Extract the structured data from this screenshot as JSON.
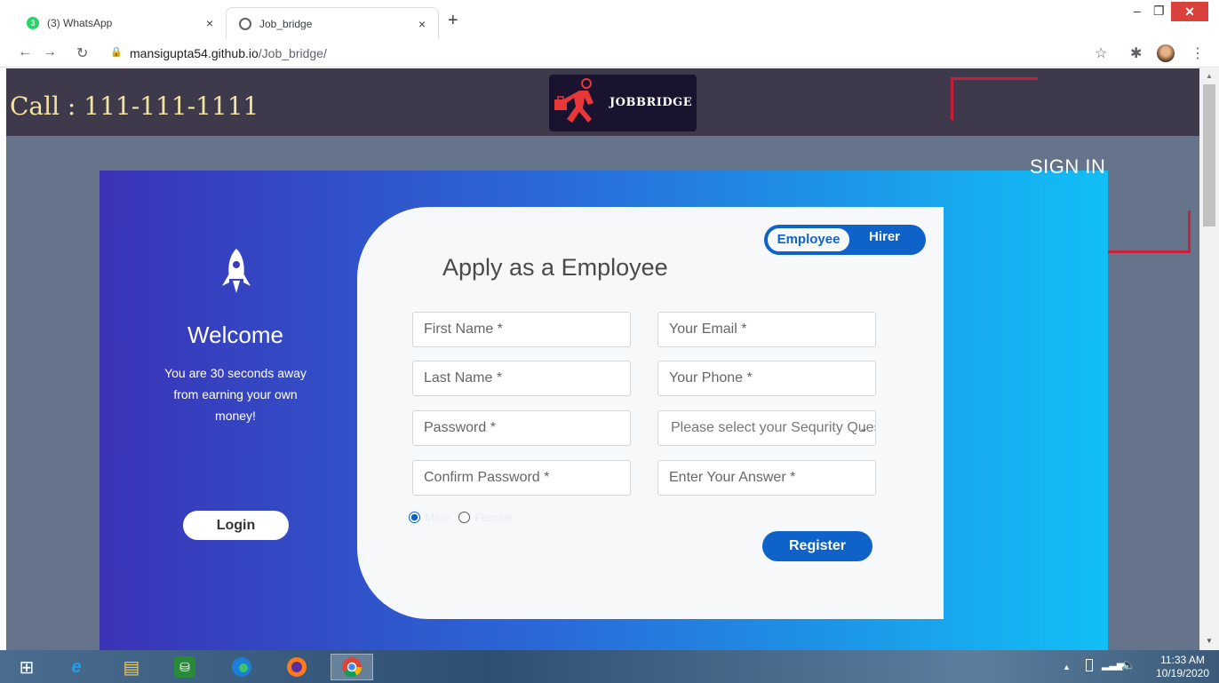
{
  "browser": {
    "tabs": [
      {
        "title": "(3) WhatsApp",
        "badge": "3",
        "active": false
      },
      {
        "title": "Job_bridge",
        "active": true
      }
    ],
    "new_tab": "+",
    "close_glyph": "×",
    "url_domain": "mansigupta54.github.io",
    "url_path": "/Job_bridge/"
  },
  "header": {
    "call_text": "Call : 111-111-1111",
    "logo_text": "JOBBRIDGE",
    "sign_in": "SIGN IN"
  },
  "welcome": {
    "title": "Welcome",
    "subtitle": "You are 30 seconds away from earning your own money!",
    "login_label": "Login"
  },
  "form": {
    "toggle": {
      "employee": "Employee",
      "hirer": "Hirer"
    },
    "title": "Apply as a Employee",
    "fields": {
      "first_name": "First Name *",
      "last_name": "Last Name *",
      "password": "Password *",
      "confirm_password": "Confirm Password *",
      "email": "Your Email *",
      "phone": "Your Phone *",
      "security_question": "Please select your Sequrity Question",
      "answer": "Enter Your Answer *"
    },
    "gender": {
      "male": "Male",
      "female": "Female",
      "selected": "male"
    },
    "register_label": "Register"
  },
  "taskbar": {
    "time": "11:33 AM",
    "date": "10/19/2020"
  },
  "colors": {
    "accent": "#0f63c8",
    "header_band": "#3e3a4c",
    "page_bg": "#65748a",
    "bracket": "#c8203a",
    "call_text": "#f2e3a0"
  }
}
